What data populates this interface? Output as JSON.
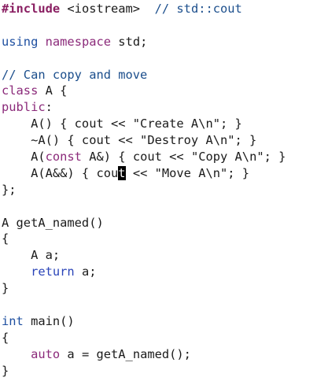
{
  "editor": {
    "lines": [
      {
        "tokens": [
          {
            "t": "#include",
            "c": "pp"
          },
          {
            "t": " <iostream>  ",
            "c": "ppinc"
          },
          {
            "t": "// std::cout",
            "c": "comment"
          }
        ]
      },
      {
        "tokens": []
      },
      {
        "tokens": [
          {
            "t": "using",
            "c": "type"
          },
          {
            "t": " ",
            "c": "plain"
          },
          {
            "t": "namespace",
            "c": "kw"
          },
          {
            "t": " std;",
            "c": "plain"
          }
        ]
      },
      {
        "tokens": []
      },
      {
        "tokens": [
          {
            "t": "// Can copy and move",
            "c": "comment"
          }
        ]
      },
      {
        "tokens": [
          {
            "t": "class",
            "c": "kw"
          },
          {
            "t": " A {",
            "c": "plain"
          }
        ]
      },
      {
        "tokens": [
          {
            "t": "public",
            "c": "kw"
          },
          {
            "t": ":",
            "c": "plain"
          }
        ]
      },
      {
        "tokens": [
          {
            "t": "    A() { cout << \"Create A\\n\"; }",
            "c": "plain"
          }
        ]
      },
      {
        "tokens": [
          {
            "t": "    ~A() { cout << \"Destroy A\\n\"; }",
            "c": "plain"
          }
        ]
      },
      {
        "tokens": [
          {
            "t": "    A(",
            "c": "plain"
          },
          {
            "t": "const",
            "c": "kw"
          },
          {
            "t": " A&) { cout << \"Copy A\\n\"; }",
            "c": "plain"
          }
        ]
      },
      {
        "tokens": [
          {
            "t": "    A(A&&) { cou",
            "c": "plain"
          },
          {
            "t": "t",
            "c": "cursor"
          },
          {
            "t": " << \"Move A\\n\"; }",
            "c": "plain"
          }
        ]
      },
      {
        "tokens": [
          {
            "t": "};",
            "c": "plain"
          }
        ]
      },
      {
        "tokens": []
      },
      {
        "tokens": [
          {
            "t": "A getA_named()",
            "c": "plain"
          }
        ]
      },
      {
        "tokens": [
          {
            "t": "{",
            "c": "plain"
          }
        ]
      },
      {
        "tokens": [
          {
            "t": "    A a;",
            "c": "plain"
          }
        ]
      },
      {
        "tokens": [
          {
            "t": "    ",
            "c": "plain"
          },
          {
            "t": "return",
            "c": "ctl"
          },
          {
            "t": " a;",
            "c": "plain"
          }
        ]
      },
      {
        "tokens": [
          {
            "t": "}",
            "c": "plain"
          }
        ]
      },
      {
        "tokens": []
      },
      {
        "tokens": [
          {
            "t": "int",
            "c": "type"
          },
          {
            "t": " main()",
            "c": "plain"
          }
        ]
      },
      {
        "tokens": [
          {
            "t": "{",
            "c": "plain"
          }
        ]
      },
      {
        "tokens": [
          {
            "t": "    ",
            "c": "plain"
          },
          {
            "t": "auto",
            "c": "kw"
          },
          {
            "t": " a = getA_named();",
            "c": "plain"
          }
        ]
      },
      {
        "tokens": [
          {
            "t": "}",
            "c": "plain"
          }
        ]
      }
    ]
  },
  "colors": {
    "background": "#ffffff",
    "preprocessor": "#8a1f62",
    "comment": "#1b4e8c",
    "keyword": "#8b2a7a",
    "type": "#1e4fa0",
    "control": "#2a44b8",
    "text": "#1a1a1a",
    "cursor": "#000000"
  }
}
